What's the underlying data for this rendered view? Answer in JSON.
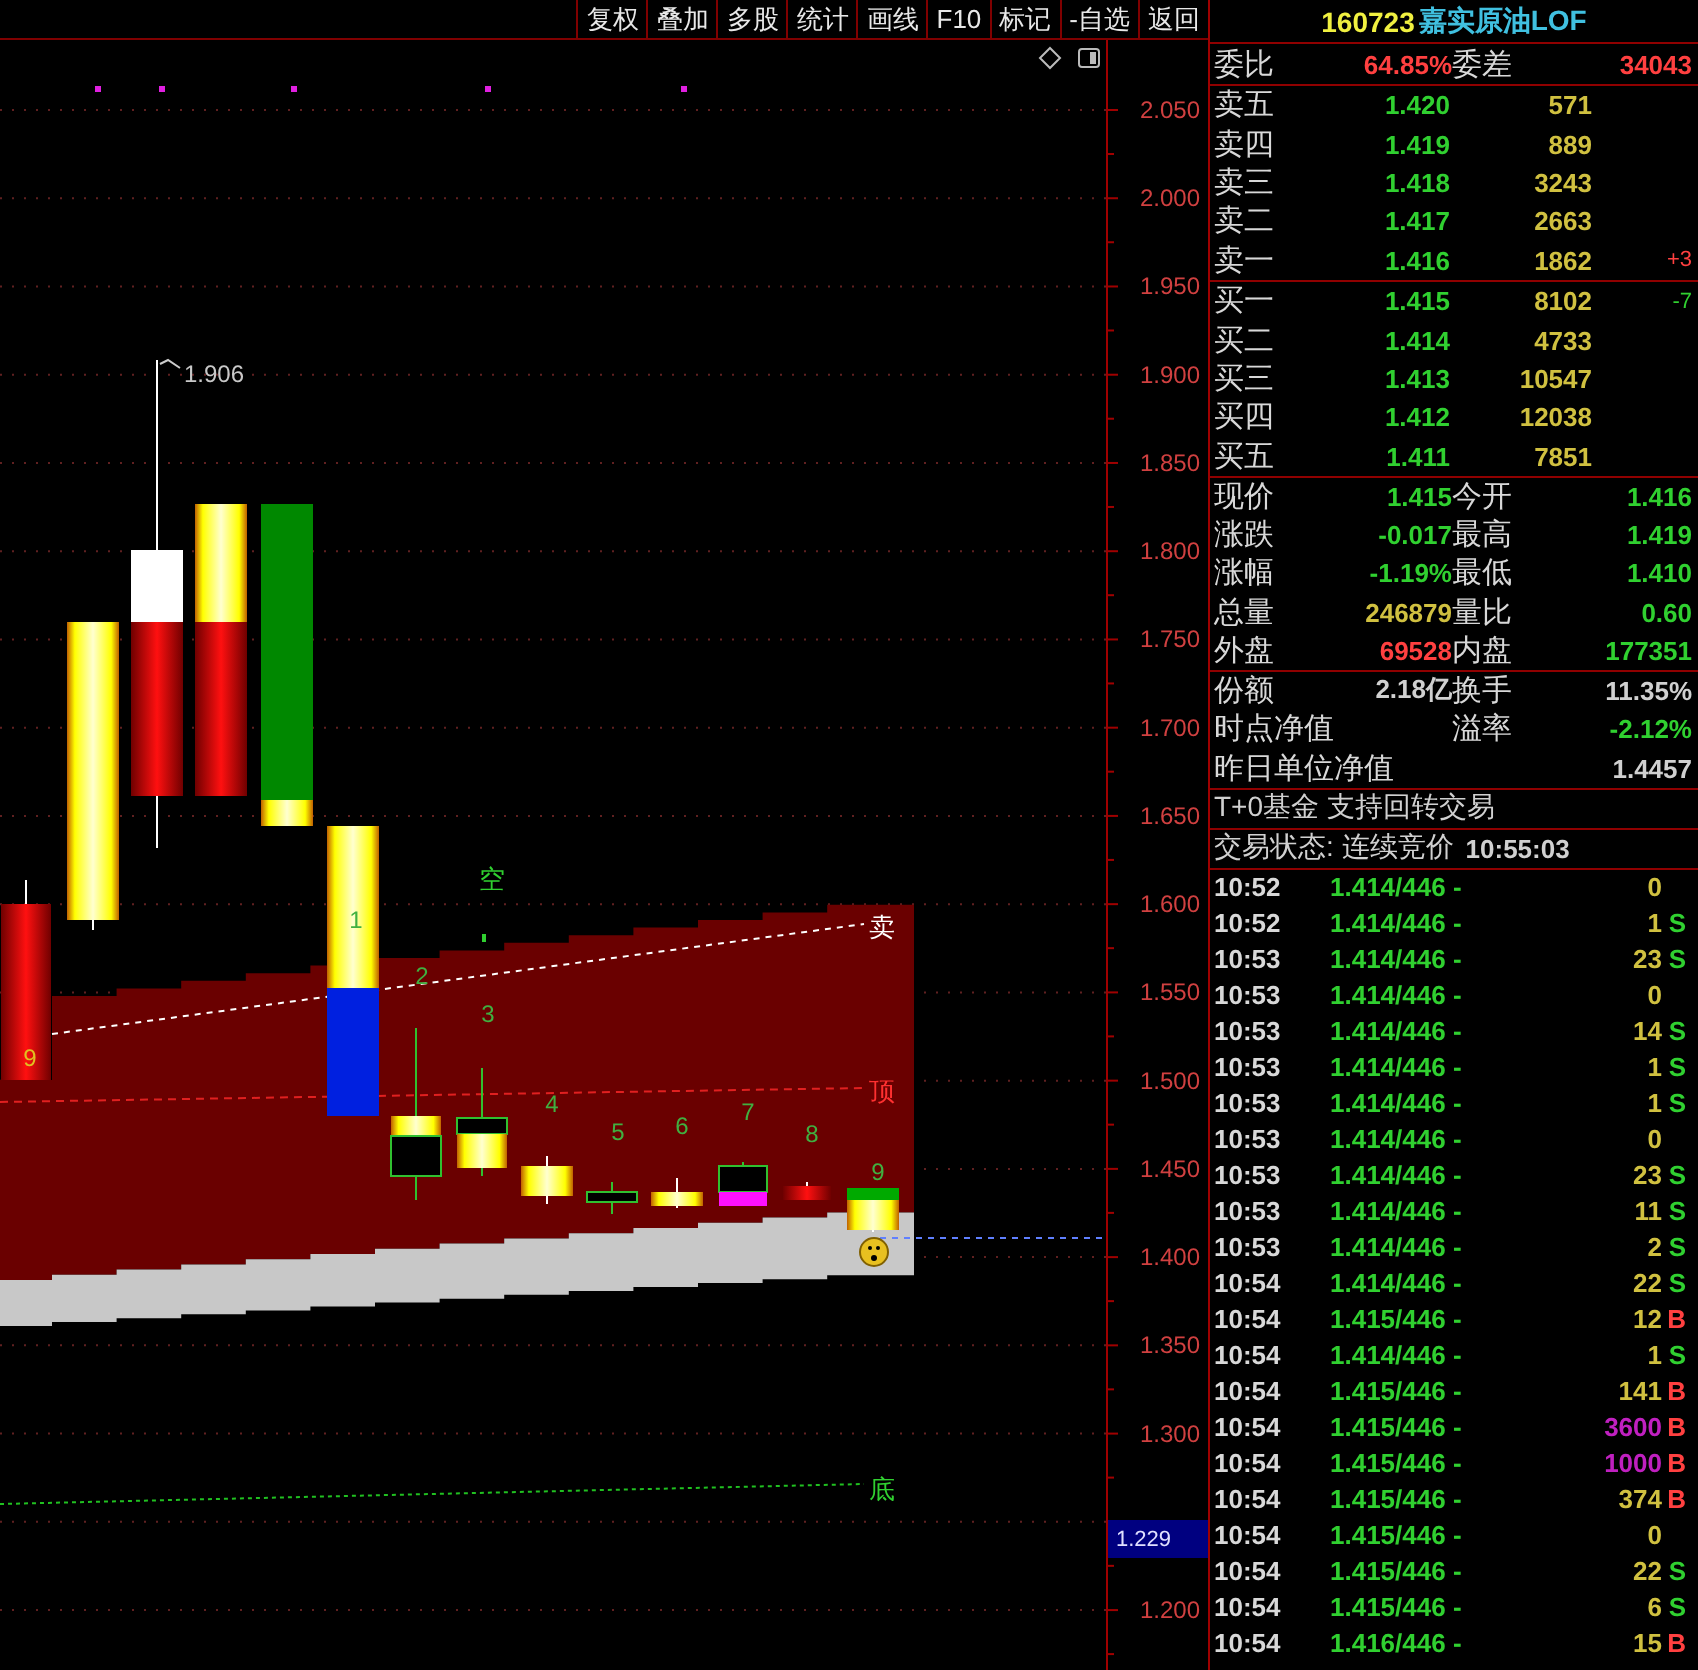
{
  "toolbar": [
    "复权",
    "叠加",
    "多股",
    "统计",
    "画线",
    "F10",
    "标记",
    "-自选",
    "返回"
  ],
  "chart": {
    "high_label": "1.906",
    "count_labels": [
      "9",
      "1",
      "2",
      "3",
      "4",
      "5",
      "6",
      "7",
      "8",
      "9"
    ],
    "signal_labels": [
      {
        "kind": "empty",
        "text": "空"
      },
      {
        "kind": "sell",
        "text": "卖"
      },
      {
        "kind": "top",
        "text": "顶"
      },
      {
        "kind": "bottom",
        "text": "底"
      }
    ],
    "axis_labels": [
      "2.050",
      "2.000",
      "1.950",
      "1.900",
      "1.850",
      "1.800",
      "1.750",
      "1.700",
      "1.650",
      "1.600",
      "1.550",
      "1.500",
      "1.450",
      "1.400",
      "1.350",
      "1.300",
      "1.200"
    ],
    "current_price": "1.229"
  },
  "quote": {
    "code": "160723",
    "name": "嘉实原油LOF",
    "ratio_label": "委比",
    "ratio": "64.85%",
    "diff_label": "委差",
    "diff": "34043",
    "asks": [
      {
        "label": "卖五",
        "price": "1.420",
        "volume": "571"
      },
      {
        "label": "卖四",
        "price": "1.419",
        "volume": "889"
      },
      {
        "label": "卖三",
        "price": "1.418",
        "volume": "3243"
      },
      {
        "label": "卖二",
        "price": "1.417",
        "volume": "2663"
      },
      {
        "label": "卖一",
        "price": "1.416",
        "volume": "1862",
        "change": "+3",
        "color": "#ff4040"
      }
    ],
    "bids": [
      {
        "label": "买一",
        "price": "1.415",
        "volume": "8102",
        "change": "-7",
        "color": "#30d030"
      },
      {
        "label": "买二",
        "price": "1.414",
        "volume": "4733"
      },
      {
        "label": "买三",
        "price": "1.413",
        "volume": "10547"
      },
      {
        "label": "买四",
        "price": "1.412",
        "volume": "12038"
      },
      {
        "label": "买五",
        "price": "1.411",
        "volume": "7851"
      }
    ],
    "stats": [
      {
        "label": "现价",
        "value": "1.415",
        "color": "#30d030"
      },
      {
        "label": "今开",
        "value": "1.416",
        "color": "#30d030"
      },
      {
        "label": "涨跌",
        "value": "-0.017",
        "color": "#30d030"
      },
      {
        "label": "最高",
        "value": "1.419",
        "color": "#30d030"
      },
      {
        "label": "涨幅",
        "value": "-1.19%",
        "color": "#30d030"
      },
      {
        "label": "最低",
        "value": "1.410",
        "color": "#30d030"
      },
      {
        "label": "总量",
        "value": "246879",
        "color": "#d0c040"
      },
      {
        "label": "量比",
        "value": "0.60",
        "color": "#30d030"
      },
      {
        "label": "外盘",
        "value": "69528",
        "color": "#ff4040"
      },
      {
        "label": "内盘",
        "value": "177351",
        "color": "#30d030"
      }
    ],
    "fund": [
      {
        "kind": "pair",
        "label": "份额",
        "value": "2.18亿",
        "color": "#d0d0d0"
      },
      {
        "kind": "pair",
        "label": "换手",
        "value": "11.35%",
        "color": "#d0d0d0"
      },
      {
        "kind": "label",
        "label": "时点净值"
      },
      {
        "kind": "pair",
        "label": "溢率",
        "value": "-2.12%",
        "color": "#30d030"
      },
      {
        "kind": "wide",
        "label": "昨日单位净值",
        "value": "1.4457",
        "color": "#d0d0d0"
      }
    ],
    "notice": "T+0基金 支持回转交易",
    "status": "交易状态: 连续竞价",
    "time": "10:55:03",
    "ticks": [
      {
        "time": "10:52",
        "price": "1.414/446 -",
        "volume": "0",
        "large": false
      },
      {
        "time": "10:52",
        "price": "1.414/446 -",
        "volume": "1",
        "large": false,
        "side": "S",
        "kind": "sell"
      },
      {
        "time": "10:53",
        "price": "1.414/446 -",
        "volume": "23",
        "large": false,
        "side": "S",
        "kind": "sell"
      },
      {
        "time": "10:53",
        "price": "1.414/446 -",
        "volume": "0",
        "large": false
      },
      {
        "time": "10:53",
        "price": "1.414/446 -",
        "volume": "14",
        "large": false,
        "side": "S",
        "kind": "sell"
      },
      {
        "time": "10:53",
        "price": "1.414/446 -",
        "volume": "1",
        "large": false,
        "side": "S",
        "kind": "sell"
      },
      {
        "time": "10:53",
        "price": "1.414/446 -",
        "volume": "1",
        "large": false,
        "side": "S",
        "kind": "sell"
      },
      {
        "time": "10:53",
        "price": "1.414/446 -",
        "volume": "0",
        "large": false
      },
      {
        "time": "10:53",
        "price": "1.414/446 -",
        "volume": "23",
        "large": false,
        "side": "S",
        "kind": "sell"
      },
      {
        "time": "10:53",
        "price": "1.414/446 -",
        "volume": "11",
        "large": false,
        "side": "S",
        "kind": "sell"
      },
      {
        "time": "10:53",
        "price": "1.414/446 -",
        "volume": "2",
        "large": false,
        "side": "S",
        "kind": "sell"
      },
      {
        "time": "10:54",
        "price": "1.414/446 -",
        "volume": "22",
        "large": false,
        "side": "S",
        "kind": "sell"
      },
      {
        "time": "10:54",
        "price": "1.415/446 -",
        "volume": "12",
        "large": false,
        "side": "B",
        "kind": "buy"
      },
      {
        "time": "10:54",
        "price": "1.414/446 -",
        "volume": "1",
        "large": false,
        "side": "S",
        "kind": "sell"
      },
      {
        "time": "10:54",
        "price": "1.415/446 -",
        "volume": "141",
        "large": false,
        "side": "B",
        "kind": "buy"
      },
      {
        "time": "10:54",
        "price": "1.415/446 -",
        "volume": "3600",
        "large": true,
        "side": "B",
        "kind": "buy"
      },
      {
        "time": "10:54",
        "price": "1.415/446 -",
        "volume": "1000",
        "large": true,
        "side": "B",
        "kind": "buy"
      },
      {
        "time": "10:54",
        "price": "1.415/446 -",
        "volume": "374",
        "large": false,
        "side": "B",
        "kind": "buy"
      },
      {
        "time": "10:54",
        "price": "1.415/446 -",
        "volume": "0",
        "large": false
      },
      {
        "time": "10:54",
        "price": "1.415/446 -",
        "volume": "22",
        "large": false,
        "side": "S",
        "kind": "sell"
      },
      {
        "time": "10:54",
        "price": "1.415/446 -",
        "volume": "6",
        "large": false,
        "side": "S",
        "kind": "sell"
      },
      {
        "time": "10:54",
        "price": "1.416/446 -",
        "volume": "15",
        "large": false,
        "side": "B",
        "kind": "buy"
      }
    ]
  }
}
